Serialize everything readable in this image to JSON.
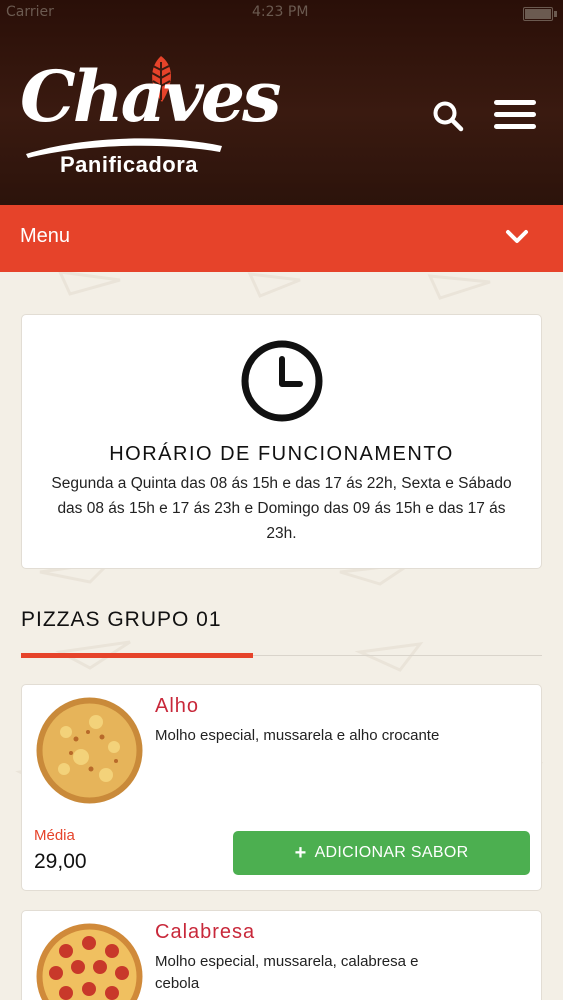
{
  "status_bar": {
    "carrier": "Carrier",
    "time": "4:23 PM"
  },
  "brand": {
    "name": "Chaves",
    "subtitle": "Panificadora"
  },
  "colors": {
    "header": "#2a0f08",
    "accent": "#e6432a",
    "product_name": "#c8283a",
    "button": "#4caf50"
  },
  "menu": {
    "label": "Menu"
  },
  "hours": {
    "title": "HORÁRIO DE FUNCIONAMENTO",
    "text": "Segunda a Quinta das 08 ás 15h e das 17 ás 22h, Sexta e Sábado das 08 ás 15h e 17 ás 23h e Domingo das 09 ás 15h e das 17 ás 23h."
  },
  "section": {
    "title": "PIZZAS GRUPO 01"
  },
  "products": [
    {
      "name": "Alho",
      "description": "Molho especial, mussarela e alho crocante",
      "size": "Média",
      "price": "29,00",
      "button": "ADICIONAR SABOR"
    },
    {
      "name": "Calabresa",
      "description": "Molho especial, mussarela, calabresa e cebola"
    }
  ]
}
